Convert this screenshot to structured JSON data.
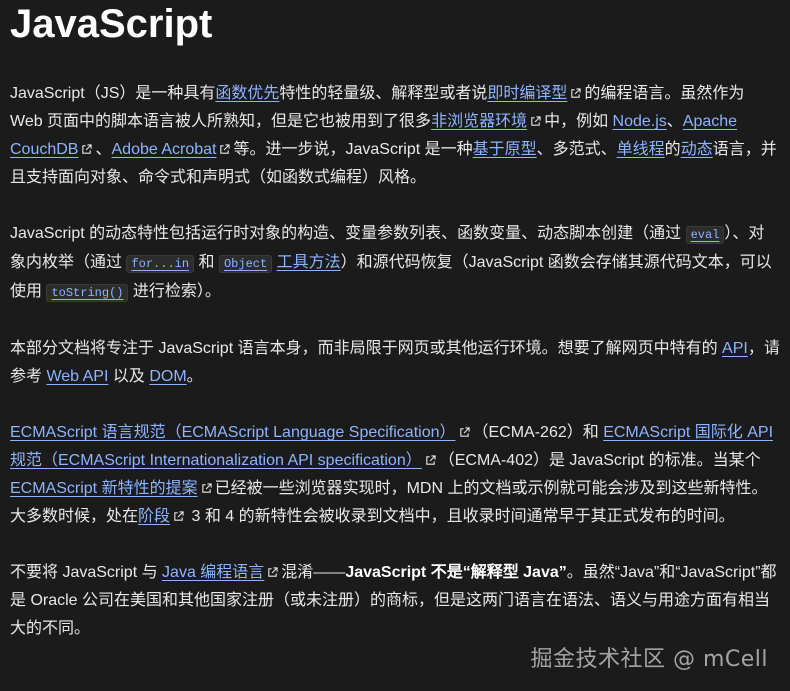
{
  "title": "JavaScript",
  "p1": {
    "t1": "JavaScript（JS）是一种具有",
    "l1": "函数优先",
    "t2": "特性的轻量级、解释型或者说",
    "l2": "即时编译型",
    "t3": "的编程语言。虽然作为 Web 页面中的脚本语言被人所熟知，但是它也被用到了很多",
    "l3": "非浏览器环境",
    "t4": "中，例如 ",
    "l4": "Node.js",
    "t5": "、",
    "l5": "Apache CouchDB",
    "t6": "、",
    "l6": "Adobe Acrobat",
    "t7": "等。进一步说，JavaScript 是一种",
    "l7": "基于原型",
    "t8": "、多范式、",
    "l8": "单线程",
    "t9": "的",
    "l9": "动态",
    "t10": "语言，并且支持面向对象、命令式和声明式（如函数式编程）风格。"
  },
  "p2": {
    "t1": "JavaScript 的动态特性包括运行时对象的构造、变量参数列表、函数变量、动态脚本创建（通过 ",
    "c1": "eval",
    "t2": "）、对象内枚举（通过 ",
    "c2": "for...in",
    "t3": " 和 ",
    "c3": "Object",
    "l1": "工具方法",
    "t4": "）和源代码恢复（JavaScript 函数会存储其源代码文本，可以使用 ",
    "c4": "toString()",
    "t5": " 进行检索）。"
  },
  "p3": {
    "t1": "本部分文档将专注于 JavaScript 语言本身，而非局限于网页或其他运行环境。想要了解网页中特有的 ",
    "l1": "API",
    "t2": "，请参考 ",
    "l2": "Web API",
    "t3": " 以及 ",
    "l3": "DOM",
    "t4": "。"
  },
  "p4": {
    "l1": "ECMAScript 语言规范（ECMAScript Language Specification）",
    "t1": "（ECMA-262）和 ",
    "l2": "ECMAScript 国际化 API 规范（ECMAScript Internationalization API specification）",
    "t2": "（ECMA-402）是 JavaScript 的标准。当某个 ",
    "l3": "ECMAScript 新特性的提案",
    "t3": "已经被一些浏览器实现时，MDN 上的文档或示例就可能会涉及到这些新特性。大多数时候，处在",
    "l4": "阶段",
    "t4": " 3 和 4 的新特性会被收录到文档中，且收录时间通常早于其正式发布的时间。"
  },
  "p5": {
    "t1": "不要将 JavaScript 与 ",
    "l1": "Java 编程语言",
    "t2": "混淆——",
    "b1": "JavaScript 不是“解释型 Java”",
    "t3": "。虽然“Java”和“JavaScript”都是 Oracle 公司在美国和其他国家注册（或未注册）的商标，但是这两门语言在语法、语义与用途方面有相当大的不同。"
  },
  "watermark": "掘金技术社区 @ mCell"
}
